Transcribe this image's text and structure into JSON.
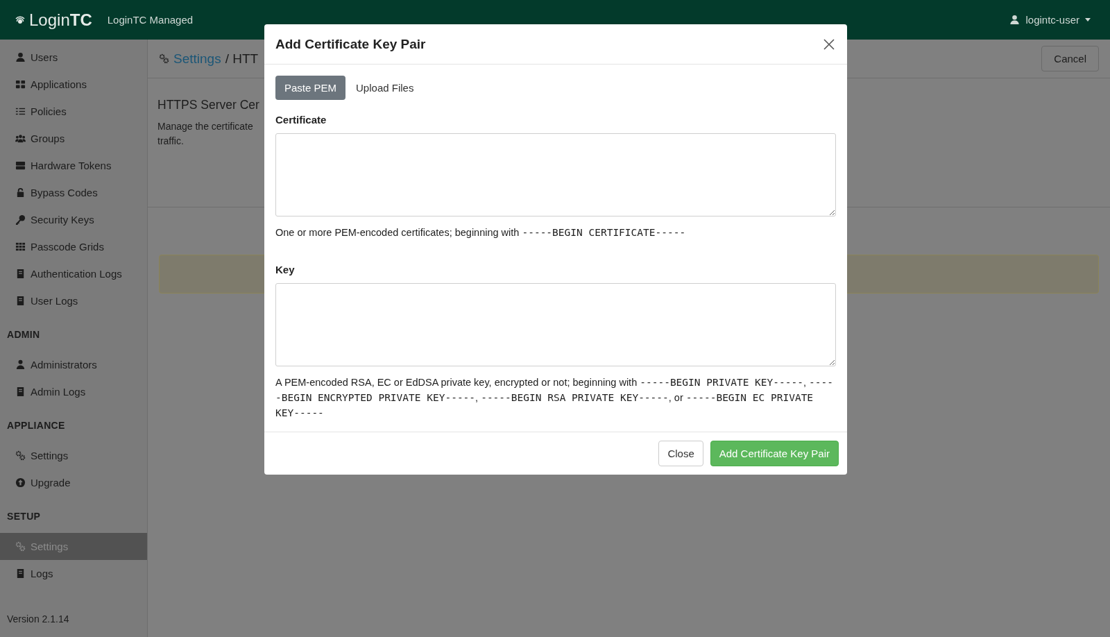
{
  "header": {
    "logo": "Login**TC**",
    "app_name": "LoginTC Managed",
    "user_menu": "logintc-user"
  },
  "sidebar": {
    "sections": [
      {
        "items": [
          {
            "label": "Users",
            "kind": "user",
            "selected": false
          },
          {
            "label": "Applications",
            "kind": "tiles",
            "selected": false
          },
          {
            "label": "Policies",
            "kind": "checklist",
            "selected": false
          },
          {
            "label": "Groups",
            "kind": "group",
            "selected": false
          },
          {
            "label": "Hardware Tokens",
            "kind": "server",
            "selected": false
          },
          {
            "label": "Bypass Codes",
            "kind": "lock",
            "selected": false
          },
          {
            "label": "Security Keys",
            "kind": "key",
            "selected": false
          },
          {
            "label": "Passcode Grids",
            "kind": "grid",
            "selected": false
          },
          {
            "label": "Authentication Logs",
            "kind": "book",
            "selected": false
          },
          {
            "label": "User Logs",
            "kind": "book",
            "selected": false
          }
        ]
      },
      {
        "heading": "ADMIN",
        "items": [
          {
            "label": "Administrators",
            "kind": "admin",
            "selected": false
          },
          {
            "label": "Admin Logs",
            "kind": "book",
            "selected": false
          }
        ]
      },
      {
        "heading": "APPLIANCE",
        "items": [
          {
            "label": "Settings",
            "kind": "gears",
            "selected": false
          },
          {
            "label": "Upgrade",
            "kind": "upload",
            "selected": false
          }
        ]
      },
      {
        "heading": "SETUP",
        "items": [
          {
            "label": "Settings",
            "kind": "gears",
            "selected": true
          },
          {
            "label": "Logs",
            "kind": "book",
            "selected": false
          }
        ]
      }
    ],
    "version": "Version 2.1.14"
  },
  "main": {
    "breadcrumb": {
      "link": "Settings",
      "rest": "/ HTT"
    },
    "cancel_button": "Cancel",
    "title": "HTTPS Server Cer",
    "description": [
      "Manage the certificate",
      "traffic."
    ]
  },
  "modal": {
    "title": "Add Certificate Key Pair",
    "tabs": [
      {
        "label": "Paste PEM",
        "selected": true
      },
      {
        "label": "Upload Files",
        "selected": false
      }
    ],
    "fields": [
      {
        "label": "Certificate",
        "help": [
          {
            "kind": "text",
            "text": "One or more PEM-encoded certificates; beginning with "
          },
          {
            "kind": "code",
            "text": "-----BEGIN CERTIFICATE-----"
          }
        ]
      },
      {
        "label": "Key",
        "help": [
          {
            "kind": "text",
            "text": "A PEM-encoded RSA, EC or EdDSA private key, encrypted or not; beginning with "
          },
          {
            "kind": "code",
            "text": "-----BEGIN PRIVATE KEY-----"
          },
          {
            "kind": "text",
            "text": ", "
          },
          {
            "kind": "code",
            "text": "-----BEGIN ENCRYPTED PRIVATE KEY-----"
          },
          {
            "kind": "text",
            "text": ", "
          },
          {
            "kind": "code",
            "text": "-----BEGIN RSA PRIVATE KEY-----"
          },
          {
            "kind": "text",
            "text": ", or "
          },
          {
            "kind": "code",
            "text": "-----BEGIN EC PRIVATE KEY-----"
          }
        ]
      }
    ],
    "buttons": [
      {
        "label": "Close",
        "kind": "secondary"
      },
      {
        "label": "Add Certificate Key Pair",
        "kind": "primary"
      }
    ]
  }
}
